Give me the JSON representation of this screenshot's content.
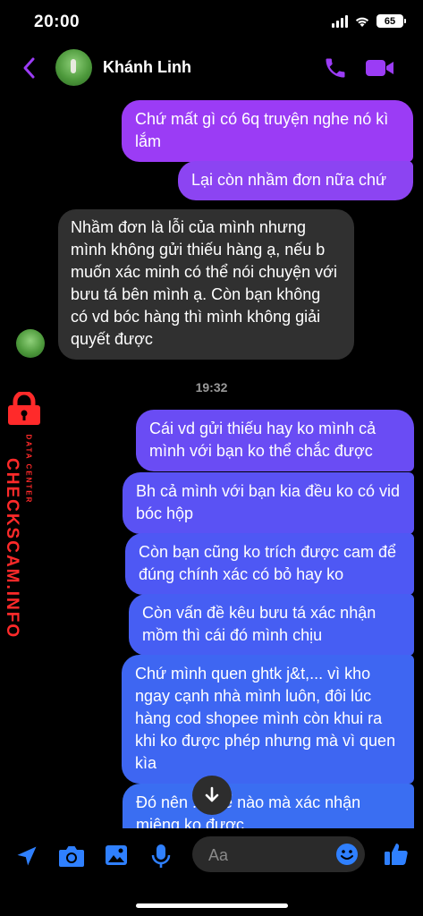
{
  "status_bar": {
    "time": "20:00",
    "battery": "65"
  },
  "header": {
    "contact_name": "Khánh Linh"
  },
  "messages": [
    {
      "text": "Chứ mất gì có 6q truyện nghe nó kì lắm"
    },
    {
      "text": "Lại còn nhầm đơn nữa chứ"
    },
    {
      "text": "Nhầm đơn là lỗi của mình nhưng mình không gửi thiếu hàng ạ, nếu b muốn xác minh có thể nói chuyện với bưu tá bên mình ạ. Còn bạn không có vd bóc hàng thì mình không giải quyết được"
    },
    {
      "text": "Cái vd gửi thiếu hay ko mình cả mình với bạn ko thể chắc được"
    },
    {
      "text": "Bh cả mình với bạn kia đều ko có vid bóc hộp"
    },
    {
      "text": "Còn bạn cũng ko trích được cam để đúng chính xác có bỏ hay ko"
    },
    {
      "text": "Còn vấn đề kêu bưu tá xác nhận mồm thì cái đó mình chịu"
    },
    {
      "text": "Chứ mình quen ghtk j&t,... vì kho ngay cạnh nhà mình luôn, đôi lúc hàng cod shopee mình còn khui ra khi ko được phép nhưng mà vì quen kìa"
    },
    {
      "text": "Đó nên ... thể nào mà xác nhận miệng ko được"
    }
  ],
  "timestamp": "19:32",
  "composer": {
    "placeholder": "Aa"
  },
  "watermark": {
    "brand": "CHECKSCAM.INFO",
    "tagline": "DATA CENTER"
  },
  "colors": {
    "accent": "#9b3cf5",
    "incoming_bubble": "#303030",
    "watermark": "#ff2a2a"
  }
}
